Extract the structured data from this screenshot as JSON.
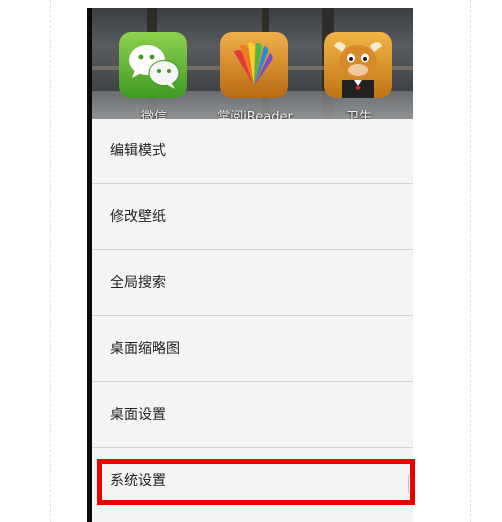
{
  "home_screen": {
    "apps": [
      {
        "id": "wechat",
        "label": "微信",
        "icon": "wechat-icon",
        "color": "#5bb531"
      },
      {
        "id": "reader",
        "label": "掌阅iReader",
        "icon": "ireader-book-icon",
        "color": "#d98a2b"
      },
      {
        "id": "qq-pet",
        "label": "卫生",
        "icon": "bull-mascot-icon",
        "color": "#e09a1f"
      }
    ]
  },
  "menu": {
    "items": [
      {
        "label": "编辑模式"
      },
      {
        "label": "修改壁纸"
      },
      {
        "label": "全局搜索"
      },
      {
        "label": "桌面缩略图"
      },
      {
        "label": "桌面设置"
      },
      {
        "label": "系统设置"
      }
    ],
    "highlighted_index": 5,
    "highlight_color": "#ee0000"
  }
}
